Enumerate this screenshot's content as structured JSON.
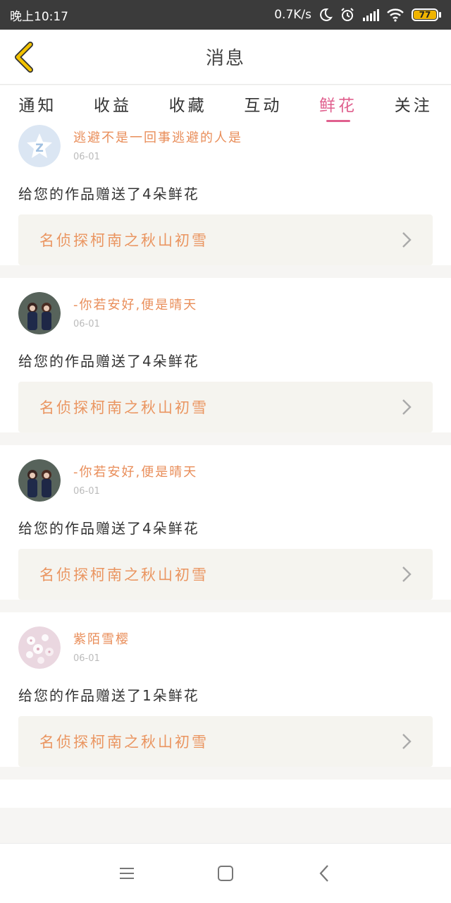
{
  "status_bar": {
    "time": "晚上10:17",
    "net_speed": "0.7K/s",
    "battery": "77"
  },
  "header": {
    "title": "消息"
  },
  "tabs": [
    {
      "label": "通知",
      "active": false
    },
    {
      "label": "收益",
      "active": false
    },
    {
      "label": "收藏",
      "active": false
    },
    {
      "label": "互动",
      "active": false
    },
    {
      "label": "鲜花",
      "active": true
    },
    {
      "label": "关注",
      "active": false
    }
  ],
  "messages": [
    {
      "name": "逃避不是一回事逃避的人是",
      "date": "06-01",
      "text": "给您的作品赠送了4朵鲜花",
      "work": "名侦探柯南之秋山初雪",
      "avatar": "default-avatar"
    },
    {
      "name": "-你若安好,便是晴天",
      "date": "06-01",
      "text": "给您的作品赠送了4朵鲜花",
      "work": "名侦探柯南之秋山初雪",
      "avatar": "photo-avatar"
    },
    {
      "name": "-你若安好,便是晴天",
      "date": "06-01",
      "text": "给您的作品赠送了4朵鲜花",
      "work": "名侦探柯南之秋山初雪",
      "avatar": "photo-avatar"
    },
    {
      "name": "紫陌雪樱",
      "date": "06-01",
      "text": "给您的作品赠送了1朵鲜花",
      "work": "名侦探柯南之秋山初雪",
      "avatar": "blossom-avatar"
    }
  ],
  "colors": {
    "accent": "#e0608e",
    "name": "#e98e5a",
    "work_title": "#ea9560",
    "back_arrow": "#f2c200"
  },
  "nav_bar": {
    "icons": [
      "menu-icon",
      "home-square-icon",
      "back-triangle-icon"
    ]
  }
}
